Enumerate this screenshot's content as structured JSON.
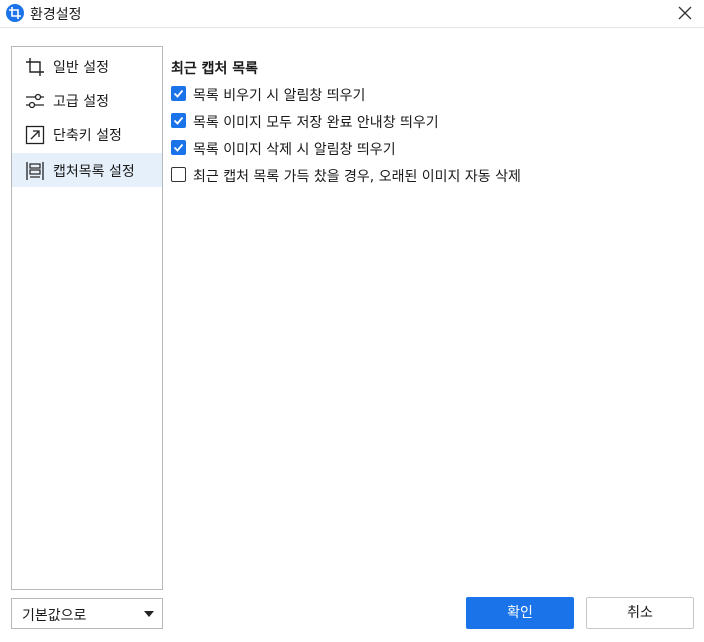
{
  "window": {
    "title": "환경설정",
    "icon": "crop-icon",
    "close_icon": "close-icon"
  },
  "sidebar": {
    "selected_index": 3,
    "items": [
      {
        "label": "일반 설정",
        "icon": "crop-icon"
      },
      {
        "label": "고급 설정",
        "icon": "sliders-icon"
      },
      {
        "label": "단축키 설정",
        "icon": "shortcut-arrow-icon"
      },
      {
        "label": "캡처목록 설정",
        "icon": "capture-list-icon"
      }
    ]
  },
  "main": {
    "section_title": "최근 캡처 목록",
    "options": [
      {
        "label": "목록 비우기 시 알림창 띄우기",
        "checked": true
      },
      {
        "label": "목록 이미지 모두 저장 완료 안내창 띄우기",
        "checked": true
      },
      {
        "label": "목록 이미지 삭제 시 알림창 띄우기",
        "checked": true
      },
      {
        "label": "최근 캡처 목록 가득 찼을 경우, 오래된 이미지 자동 삭제",
        "checked": false
      }
    ]
  },
  "footer": {
    "defaults_dropdown": "기본값으로",
    "ok_label": "확인",
    "cancel_label": "취소"
  },
  "colors": {
    "accent": "#1a73e8",
    "selected_bg": "#e6f0fb"
  }
}
